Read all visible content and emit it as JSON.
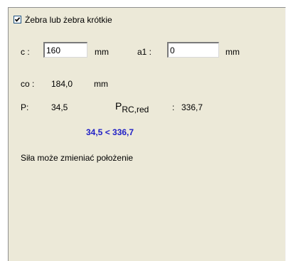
{
  "ribs": {
    "checkbox_label": "Żebra lub żebra krótkie",
    "checked": true
  },
  "inputs": {
    "c_label": "c :",
    "c_value": "160",
    "c_unit": "mm",
    "a1_label": "a1 :",
    "a1_value": "0",
    "a1_unit": "mm"
  },
  "results": {
    "co_label": "co :",
    "co_value": "184,0",
    "co_unit": "mm",
    "p_label": "P:",
    "p_value": "34,5",
    "prc_symbol": "P",
    "prc_subscript": "RC,red",
    "prc_colon": ":",
    "prc_value": "336,7",
    "comparison": "34,5 < 336,7",
    "message": "Siła może zmieniać położenie"
  },
  "colors": {
    "panel_bg": "#ece9d8",
    "comparison_text": "#1f1fc6"
  }
}
